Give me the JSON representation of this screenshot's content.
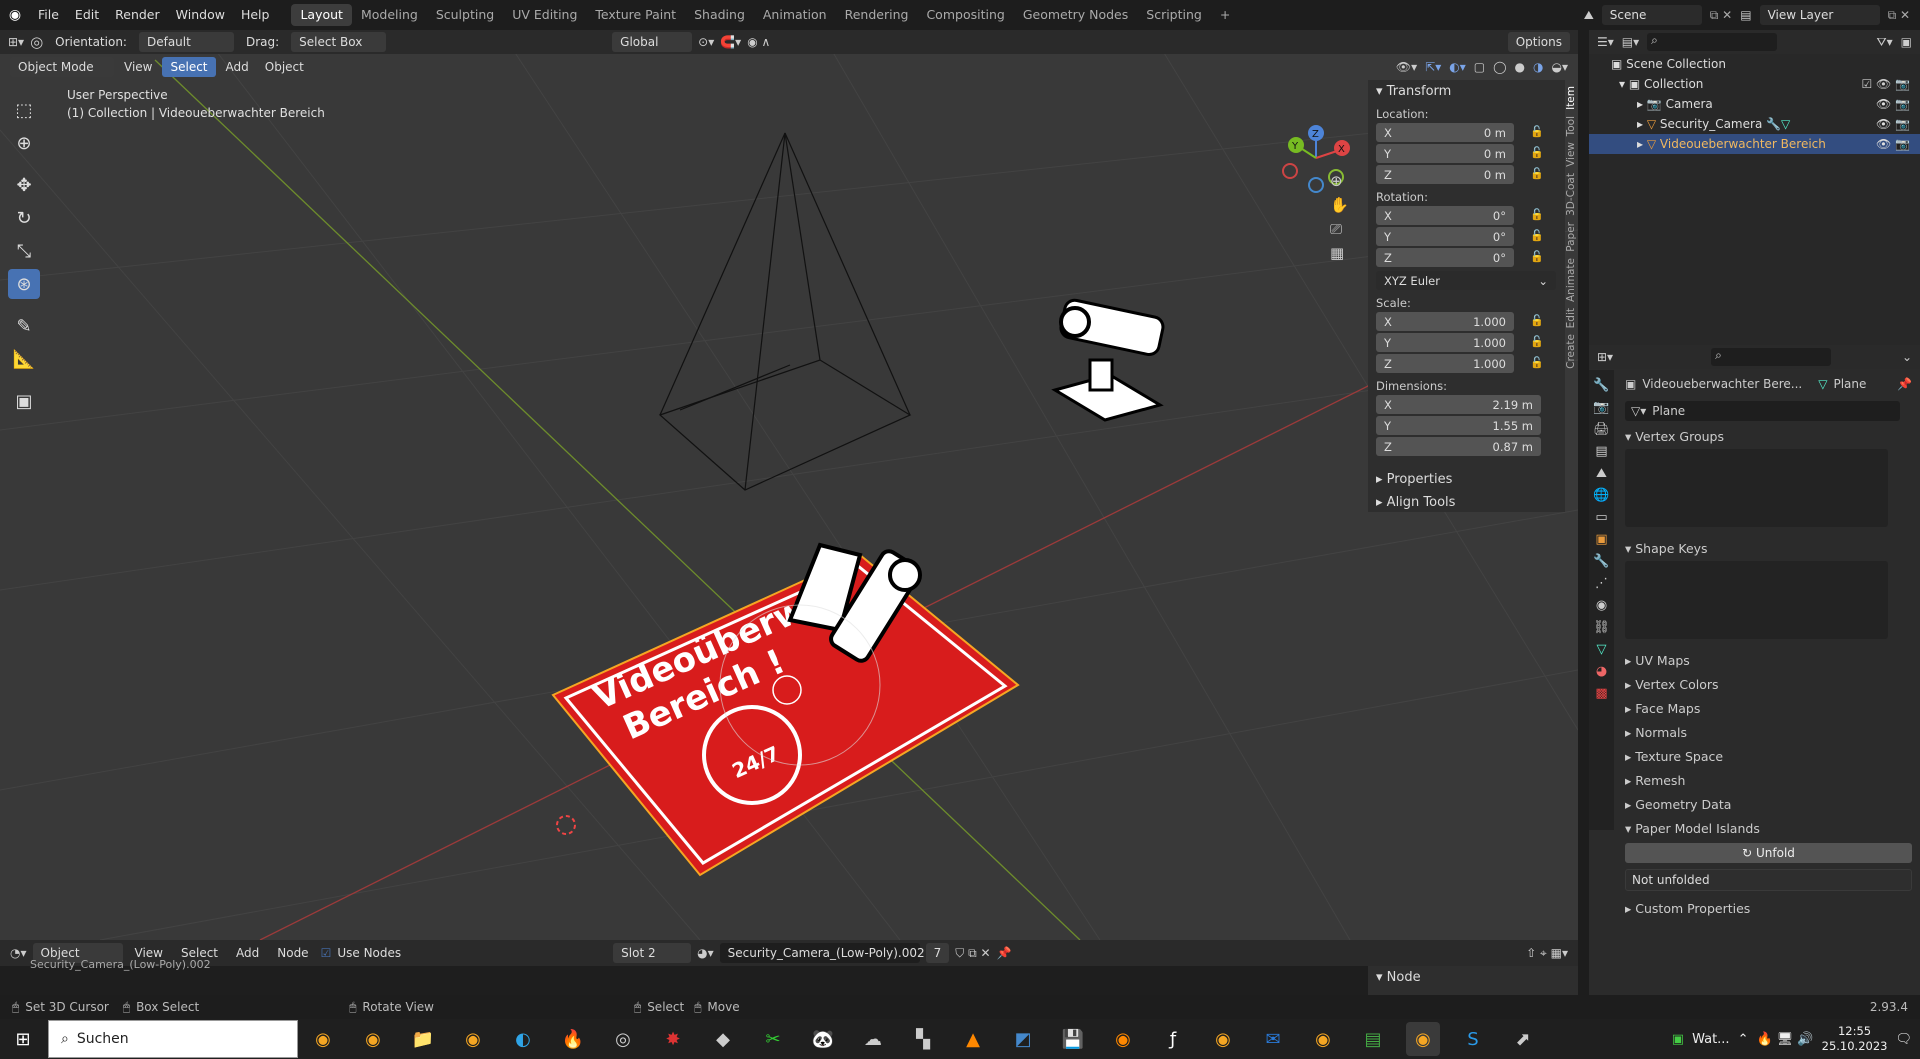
{
  "topbar": {
    "menus": [
      "File",
      "Edit",
      "Render",
      "Window",
      "Help"
    ],
    "workspaces": [
      "Layout",
      "Modeling",
      "Sculpting",
      "UV Editing",
      "Texture Paint",
      "Shading",
      "Animation",
      "Rendering",
      "Compositing",
      "Geometry Nodes",
      "Scripting"
    ],
    "active_workspace": "Layout",
    "scene": "Scene",
    "view_layer": "View Layer"
  },
  "header": {
    "orientation_label": "Orientation:",
    "orientation_value": "Default",
    "drag_label": "Drag:",
    "drag_value": "Select Box",
    "transform_space": "Global",
    "options": "Options",
    "mode": "Object Mode",
    "view": "View",
    "select": "Select",
    "add": "Add",
    "object": "Object"
  },
  "viewport": {
    "perspective": "User Perspective",
    "collection_info": "(1) Collection | Videoueberwachter Bereich",
    "sign_line1": "Videoüberw",
    "sign_line2": "Bereich !",
    "sign_badge": "24/7",
    "gizmo": {
      "x": "X",
      "y": "Y",
      "z": "Z"
    }
  },
  "npanel": {
    "transform": "Transform",
    "location_label": "Location:",
    "location": [
      {
        "axis": "X",
        "value": "0 m"
      },
      {
        "axis": "Y",
        "value": "0 m"
      },
      {
        "axis": "Z",
        "value": "0 m"
      }
    ],
    "rotation_label": "Rotation:",
    "rotation": [
      {
        "axis": "X",
        "value": "0°"
      },
      {
        "axis": "Y",
        "value": "0°"
      },
      {
        "axis": "Z",
        "value": "0°"
      }
    ],
    "rotation_mode": "XYZ Euler",
    "scale_label": "Scale:",
    "scale": [
      {
        "axis": "X",
        "value": "1.000"
      },
      {
        "axis": "Y",
        "value": "1.000"
      },
      {
        "axis": "Z",
        "value": "1.000"
      }
    ],
    "dimensions_label": "Dimensions:",
    "dimensions": [
      {
        "axis": "X",
        "value": "2.19 m"
      },
      {
        "axis": "Y",
        "value": "1.55 m"
      },
      {
        "axis": "Z",
        "value": "0.87 m"
      }
    ],
    "properties": "Properties",
    "align_tools": "Align Tools",
    "tabs": [
      "Item",
      "Tool",
      "View",
      "3D-Coat",
      "Paper",
      "Animate",
      "Edit",
      "Create"
    ]
  },
  "outliner": {
    "scene_collection": "Scene Collection",
    "collection": "Collection",
    "items": [
      "Camera",
      "Security_Camera",
      "Videoueberwachter Bereich"
    ]
  },
  "properties": {
    "object_name": "Videoueberwachter Bere...",
    "data_type": "Plane",
    "mesh_name": "Plane",
    "vertex_groups": "Vertex Groups",
    "shape_keys": "Shape Keys",
    "sections": [
      "UV Maps",
      "Vertex Colors",
      "Face Maps",
      "Normals",
      "Texture Space",
      "Remesh",
      "Geometry Data"
    ],
    "paper_model": "Paper Model Islands",
    "unfold": "Unfold",
    "not_unfolded": "Not unfolded",
    "custom_props": "Custom Properties"
  },
  "node_editor": {
    "object": "Object",
    "view": "View",
    "select": "Select",
    "add": "Add",
    "node": "Node",
    "use_nodes": "Use Nodes",
    "slot": "Slot 2",
    "material": "Security_Camera_(Low-Poly).002",
    "users": "7",
    "sidebar_node": "Node",
    "material_overflow": "Security_Camera_(Low-Poly).002"
  },
  "statusbar": {
    "set_cursor": "Set 3D Cursor",
    "box_select": "Box Select",
    "rotate_view": "Rotate View",
    "select": "Select",
    "move": "Move",
    "version": "2.93.4"
  },
  "taskbar": {
    "search": "Suchen",
    "weather": "Wat...",
    "time": "12:55",
    "date": "25.10.2023"
  },
  "colors": {
    "accent": "#4772b3",
    "sign_red": "#d81c1c",
    "selected_orange": "#f5a623"
  }
}
